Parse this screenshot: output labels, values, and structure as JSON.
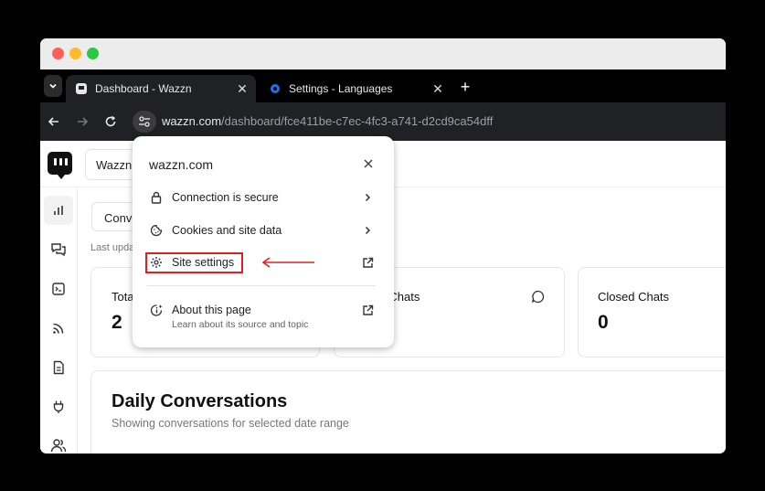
{
  "browser": {
    "tabs": [
      {
        "title": "Dashboard - Wazzn",
        "active": true,
        "close_glyph": "✕"
      },
      {
        "title": "Settings - Languages",
        "active": false,
        "close_glyph": "✕"
      }
    ],
    "new_tab_glyph": "+",
    "url_host": "wazzn.com",
    "url_path": "/dashboard/fce411be-c7ec-4fc3-a741-d2cd9ca54dff"
  },
  "app": {
    "workspace_label": "Wazzn",
    "active_tab_label": "Conversations",
    "last_updated": "Last updated",
    "cards": [
      {
        "label": "Total Chats",
        "value": "2"
      },
      {
        "label": "Open Chats",
        "value": ""
      },
      {
        "label": "Closed Chats",
        "value": "0"
      }
    ],
    "daily": {
      "title": "Daily Conversations",
      "subtitle": "Showing conversations for selected date range"
    }
  },
  "popup": {
    "host": "wazzn.com",
    "items": [
      {
        "label": "Connection is secure",
        "icon": "lock-icon"
      },
      {
        "label": "Cookies and site data",
        "icon": "cookie-icon"
      },
      {
        "label": "Site settings",
        "icon": "gear-icon"
      },
      {
        "label": "About this page",
        "sub": "Learn about its source and topic",
        "icon": "info-sparkle-icon"
      }
    ]
  },
  "colors": {
    "highlight": "#e02020",
    "tab_accent": "#1a73e8"
  }
}
